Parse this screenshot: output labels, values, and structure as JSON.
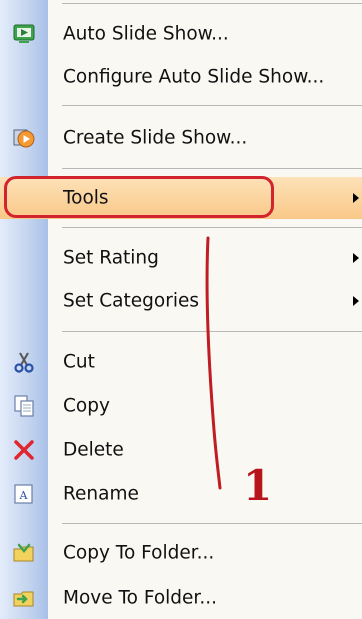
{
  "menu": {
    "items": [
      {
        "label": "Auto Slide Show...",
        "icon": "slideshow-play-icon"
      },
      {
        "label": "Configure Auto Slide Show...",
        "icon": ""
      },
      {
        "label": "Create Slide Show...",
        "icon": "create-slideshow-icon"
      },
      {
        "label": "Tools",
        "submenu": true,
        "highlighted": true
      },
      {
        "label": "Set Rating",
        "submenu": true
      },
      {
        "label": "Set Categories",
        "submenu": true
      },
      {
        "label": "Cut",
        "icon": "scissors-icon"
      },
      {
        "label": "Copy",
        "icon": "copy-icon"
      },
      {
        "label": "Delete",
        "icon": "delete-x-icon"
      },
      {
        "label": "Rename",
        "icon": "rename-icon"
      },
      {
        "label": "Copy To Folder...",
        "icon": "copy-to-folder-icon"
      },
      {
        "label": "Move To Folder...",
        "icon": "move-to-folder-icon"
      }
    ]
  },
  "annotation": {
    "number": "1",
    "color": "#d2242e"
  },
  "colors": {
    "highlight": "#f9c888",
    "gutter": "#a9c0e8"
  }
}
